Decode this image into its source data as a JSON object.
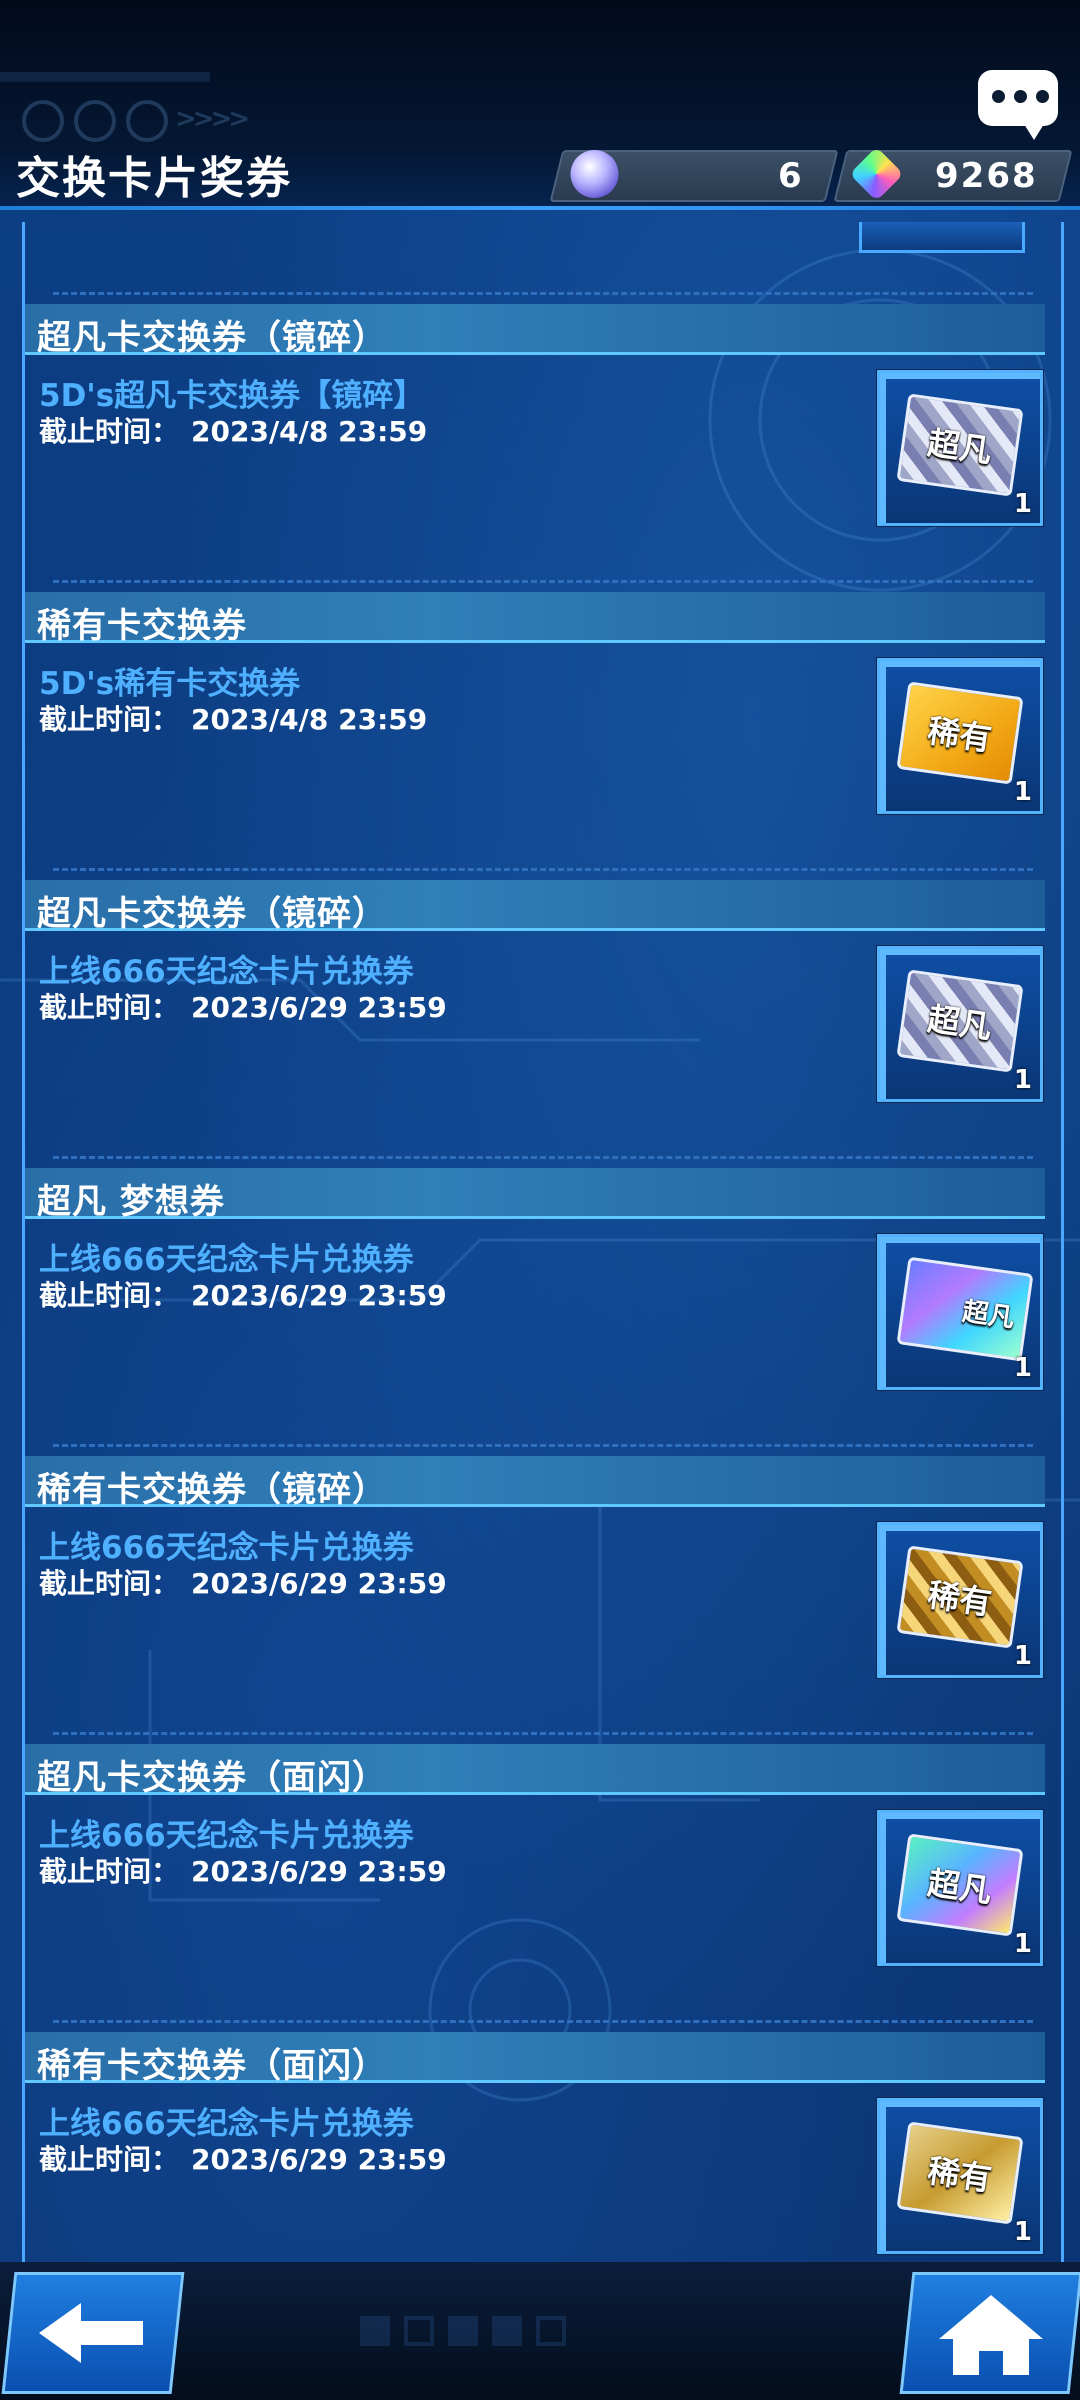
{
  "header": {
    "title": "交换卡片奖券",
    "currency_orbs": "6",
    "currency_gems": "9268"
  },
  "items": [
    {
      "title": "超凡卡交换券（镜碎）",
      "subtitle": "5D's超凡卡交换券【镜碎】",
      "deadline_label": "截止时间：",
      "deadline": "2023/4/8 23:59",
      "ticket_label": "超凡",
      "count": "1",
      "style": "t-sr-mirror"
    },
    {
      "title": "稀有卡交换券",
      "subtitle": "5D's稀有卡交换券",
      "deadline_label": "截止时间：",
      "deadline": "2023/4/8 23:59",
      "ticket_label": "稀有",
      "count": "1",
      "style": "t-r"
    },
    {
      "title": "超凡卡交换券（镜碎）",
      "subtitle": "上线666天纪念卡片兑换券",
      "deadline_label": "截止时间：",
      "deadline": "2023/6/29 23:59",
      "ticket_label": "超凡",
      "count": "1",
      "style": "t-sr-mirror"
    },
    {
      "title": "超凡 梦想券",
      "subtitle": "上线666天纪念卡片兑换券",
      "deadline_label": "截止时间：",
      "deadline": "2023/6/29 23:59",
      "ticket_label": "超凡",
      "count": "1",
      "style": "t-dream"
    },
    {
      "title": "稀有卡交换券（镜碎）",
      "subtitle": "上线666天纪念卡片兑换券",
      "deadline_label": "截止时间：",
      "deadline": "2023/6/29 23:59",
      "ticket_label": "稀有",
      "count": "1",
      "style": "t-r-mirror"
    },
    {
      "title": "超凡卡交换券（面闪）",
      "subtitle": "上线666天纪念卡片兑换券",
      "deadline_label": "截止时间：",
      "deadline": "2023/6/29 23:59",
      "ticket_label": "超凡",
      "count": "1",
      "style": "t-sr-face"
    },
    {
      "title": "稀有卡交换券（面闪）",
      "subtitle": "上线666天纪念卡片兑换券",
      "deadline_label": "截止时间：",
      "deadline": "2023/6/29 23:59",
      "ticket_label": "稀有",
      "count": "1",
      "style": "t-r-face"
    }
  ],
  "icons": {
    "chat": "chat-bubble-icon",
    "orb": "orb-currency-icon",
    "gem": "gem-currency-icon",
    "back": "back-arrow-icon",
    "home": "home-icon"
  }
}
